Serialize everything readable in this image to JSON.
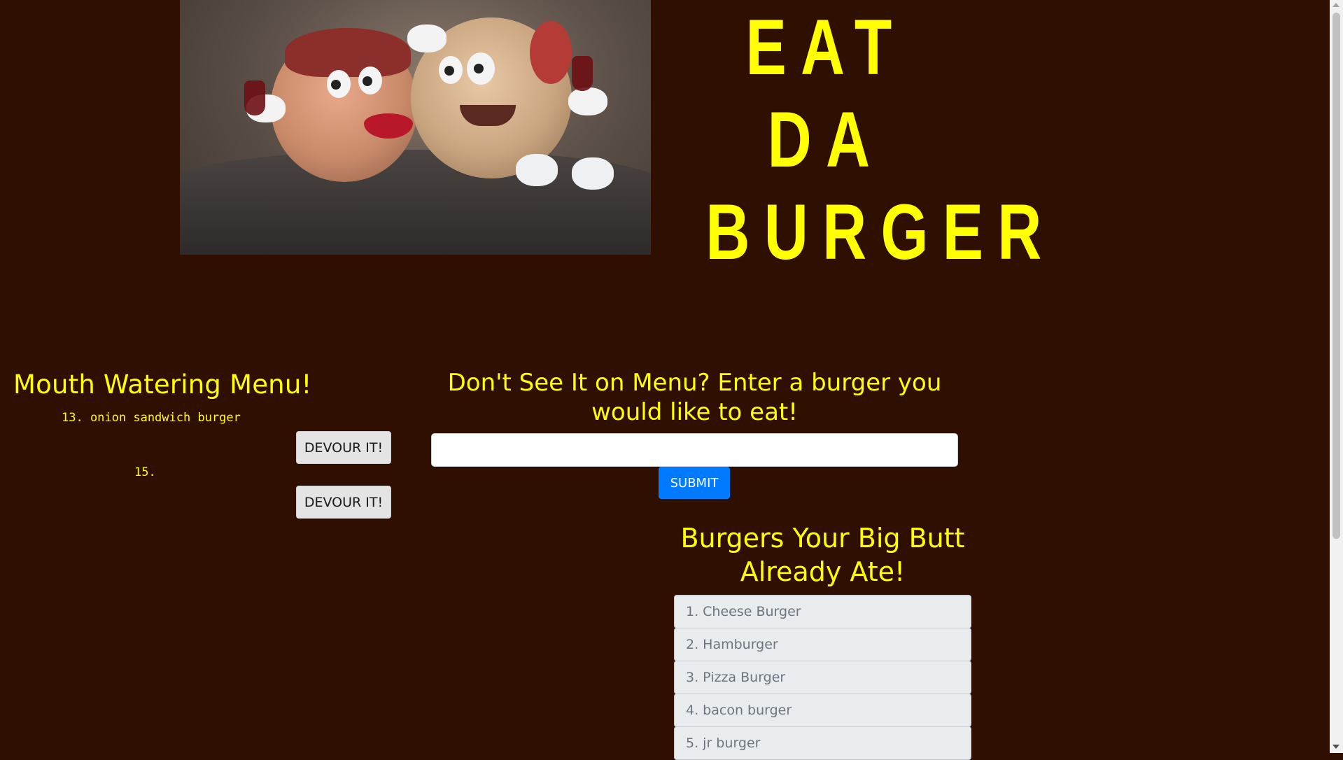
{
  "header": {
    "title_lines": [
      "EAT",
      "DA",
      "BURGER"
    ],
    "hero_image": "dancing-burgers-image"
  },
  "menu": {
    "heading": "Mouth Watering Menu!",
    "items": [
      {
        "text": "13. onion sandwich burger",
        "button_label": "DEVOUR IT!"
      },
      {
        "text": "15.",
        "button_label": "DEVOUR IT!"
      }
    ]
  },
  "submit_form": {
    "heading": "Don't See It on Menu? Enter a burger you would like to eat!",
    "input_value": "",
    "submit_label": "SUBMIT"
  },
  "eaten": {
    "heading": "Burgers Your Big Butt Already Ate!",
    "items": [
      "1. Cheese Burger",
      "2. Hamburger",
      "3. Pizza Burger",
      "4. bacon burger",
      "5. jr burger"
    ]
  },
  "colors": {
    "background": "#2f0f00",
    "accent_yellow": "#ffff00",
    "submit_blue": "#007bff"
  }
}
